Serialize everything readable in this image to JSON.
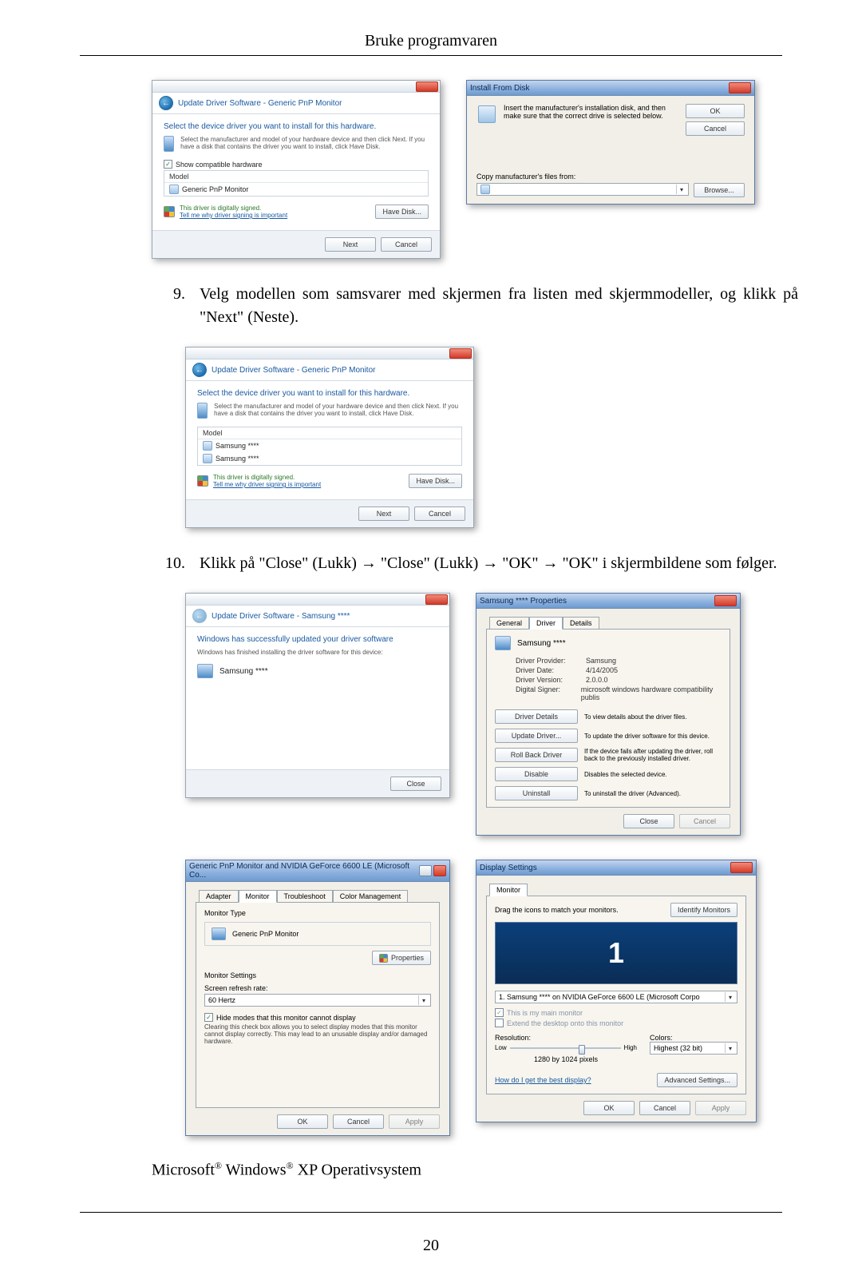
{
  "doc": {
    "header": "Bruke programvaren",
    "page_number": "20",
    "subheading_prefix": "Microsoft",
    "subheading_mid": " Windows",
    "subheading_suffix": " XP Operativsystem"
  },
  "steps": {
    "s9_num": "9.",
    "s9_text": "Velg modellen som samsvarer med skjermen fra listen med skjermmodeller, og klikk på \"Next\" (Neste).",
    "s10_num": "10.",
    "s10_text": "Klikk på \"Close\" (Lukk) → \"Close\" (Lukk) → \"OK\" → \"OK\" i skjermbildene som følger."
  },
  "wizard_select": {
    "crumb": "Update Driver Software - Generic PnP Monitor",
    "heading": "Select the device driver you want to install for this hardware.",
    "desc": "Select the manufacturer and model of your hardware device and then click Next. If you have a disk that contains the driver you want to install, click Have Disk.",
    "show_compat": "Show compatible hardware",
    "list_header": "Model",
    "item_generic": "Generic PnP Monitor",
    "signed": "This driver is digitally signed.",
    "signed_link": "Tell me why driver signing is important",
    "have_disk": "Have Disk...",
    "next": "Next",
    "cancel": "Cancel"
  },
  "install_disk": {
    "title": "Install From Disk",
    "desc": "Insert the manufacturer's installation disk, and then make sure that the correct drive is selected below.",
    "copy_label": "Copy manufacturer's files from:",
    "ok": "OK",
    "cancel": "Cancel",
    "browse": "Browse..."
  },
  "wizard_samsung": {
    "crumb": "Update Driver Software - Generic PnP Monitor",
    "heading": "Select the device driver you want to install for this hardware.",
    "desc": "Select the manufacturer and model of your hardware device and then click Next. If you have a disk that contains the driver you want to install, click Have Disk.",
    "list_header": "Model",
    "item1": "Samsung ****",
    "item2": "Samsung ****",
    "signed": "This driver is digitally signed.",
    "signed_link": "Tell me why driver signing is important",
    "have_disk": "Have Disk...",
    "next": "Next",
    "cancel": "Cancel"
  },
  "wizard_success": {
    "crumb": "Update Driver Software - Samsung ****",
    "heading": "Windows has successfully updated your driver software",
    "sub": "Windows has finished installing the driver software for this device:",
    "device": "Samsung ****",
    "close": "Close"
  },
  "props": {
    "title": "Samsung **** Properties",
    "tab_general": "General",
    "tab_driver": "Driver",
    "tab_details": "Details",
    "device": "Samsung ****",
    "provider_k": "Driver Provider:",
    "provider_v": "Samsung",
    "date_k": "Driver Date:",
    "date_v": "4/14/2005",
    "version_k": "Driver Version:",
    "version_v": "2.0.0.0",
    "signer_k": "Digital Signer:",
    "signer_v": "microsoft windows hardware compatibility publis",
    "btn_details": "Driver Details",
    "btn_details_d": "To view details about the driver files.",
    "btn_update": "Update Driver...",
    "btn_update_d": "To update the driver software for this device.",
    "btn_rollback": "Roll Back Driver",
    "btn_rollback_d": "If the device fails after updating the driver, roll back to the previously installed driver.",
    "btn_disable": "Disable",
    "btn_disable_d": "Disables the selected device.",
    "btn_uninstall": "Uninstall",
    "btn_uninstall_d": "To uninstall the driver (Advanced).",
    "close": "Close",
    "cancel": "Cancel"
  },
  "monprops": {
    "title": "Generic PnP Monitor and NVIDIA GeForce 6600 LE (Microsoft Co...",
    "tab_adapter": "Adapter",
    "tab_monitor": "Monitor",
    "tab_trouble": "Troubleshoot",
    "tab_color": "Color Management",
    "montype_lbl": "Monitor Type",
    "montype_val": "Generic PnP Monitor",
    "properties": "Properties",
    "settings_lbl": "Monitor Settings",
    "refresh_lbl": "Screen refresh rate:",
    "refresh_val": "60 Hertz",
    "hide_chk": "Hide modes that this monitor cannot display",
    "hide_desc": "Clearing this check box allows you to select display modes that this monitor cannot display correctly. This may lead to an unusable display and/or damaged hardware.",
    "ok": "OK",
    "cancel": "Cancel",
    "apply": "Apply"
  },
  "dispset": {
    "title": "Display Settings",
    "tab_monitor": "Monitor",
    "drag": "Drag the icons to match your monitors.",
    "identify": "Identify Monitors",
    "preview_num": "1",
    "monitor_sel": "1. Samsung **** on NVIDIA GeForce 6600 LE (Microsoft Corpo",
    "main_chk": "This is my main monitor",
    "extend_chk": "Extend the desktop onto this monitor",
    "res_lbl": "Resolution:",
    "low": "Low",
    "high": "High",
    "res_val": "1280 by 1024 pixels",
    "colors_lbl": "Colors:",
    "colors_val": "Highest (32 bit)",
    "help_link": "How do I get the best display?",
    "advanced": "Advanced Settings...",
    "ok": "OK",
    "cancel": "Cancel",
    "apply": "Apply"
  }
}
